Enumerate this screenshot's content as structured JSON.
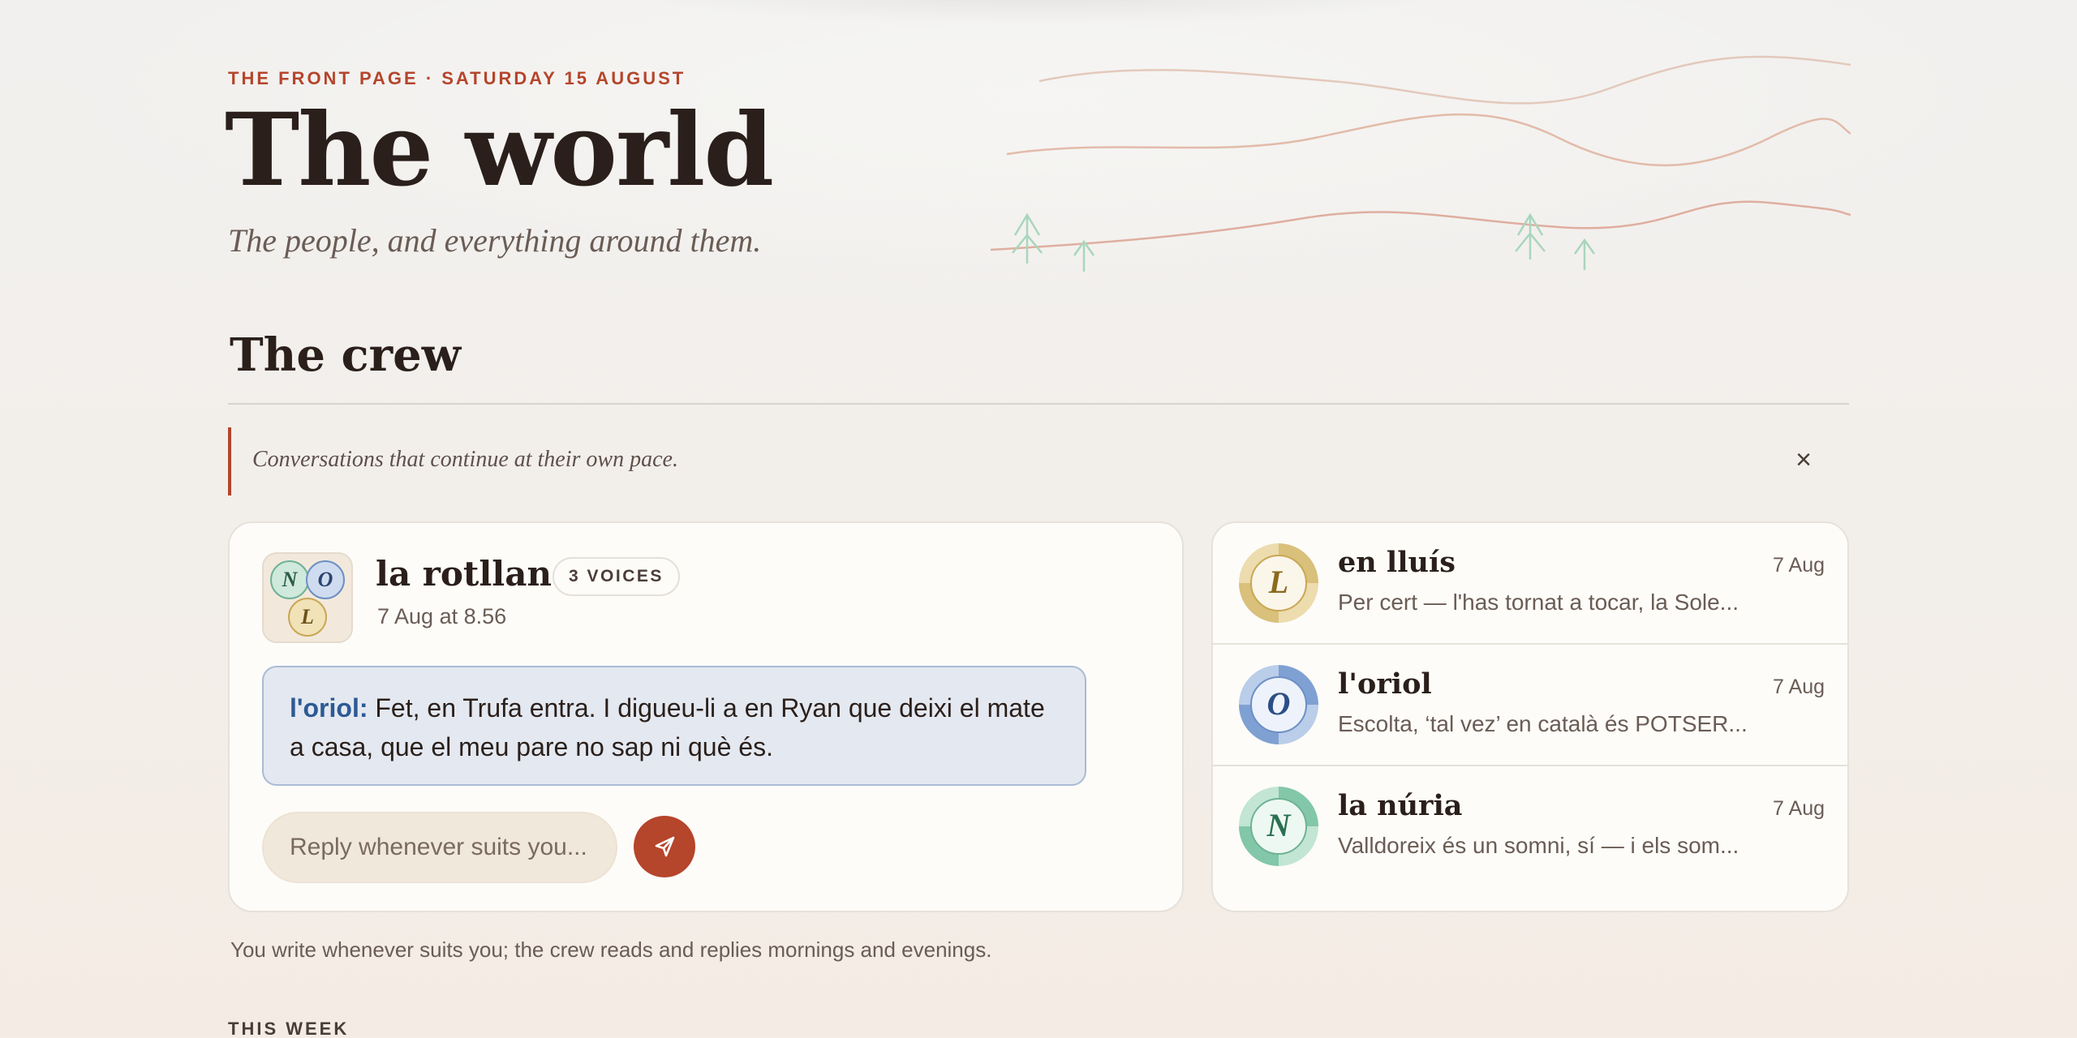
{
  "masthead": {
    "kicker": "THE FRONT PAGE · SATURDAY 15 AUGUST",
    "title": "The world",
    "deck": "The people, and everything around them."
  },
  "crew": {
    "title": "The crew",
    "note": "Conversations that continue at their own pace.",
    "close_label": "×",
    "group": {
      "name": "la rotllana",
      "voices_badge": "3 VOICES",
      "timestamp": "7 Aug at 8.56",
      "avatar_initials": [
        "N",
        "O",
        "L"
      ],
      "message_author": "l'oriol:",
      "message_text": "Fet, en Trufa entra. I digueu-li a en Ryan que deixi el mate a casa, que el meu pare no sap ni què és.",
      "reply_placeholder": "Reply whenever suits you...",
      "send_icon": "send-icon"
    },
    "threads": [
      {
        "initial": "L",
        "name": "en lluís",
        "date": "7 Aug",
        "preview": "Per cert — l'has tornat a tocar, la Sole...",
        "color": "#c9a754"
      },
      {
        "initial": "O",
        "name": "l'oriol",
        "date": "7 Aug",
        "preview": "Escolta, ‘tal vez’ en català és POTSER...",
        "color": "#6d8fc4"
      },
      {
        "initial": "N",
        "name": "la núria",
        "date": "7 Aug",
        "preview": "Valldoreix és un somni, sí — i els som...",
        "color": "#6fb294"
      }
    ],
    "footnote": "You write whenever suits you; the crew reads and replies mornings and evenings."
  },
  "this_week": {
    "label": "THIS WEEK"
  },
  "colors": {
    "accent": "#b5452b",
    "ink": "#2a1f1a",
    "muted": "#6a5c55"
  }
}
